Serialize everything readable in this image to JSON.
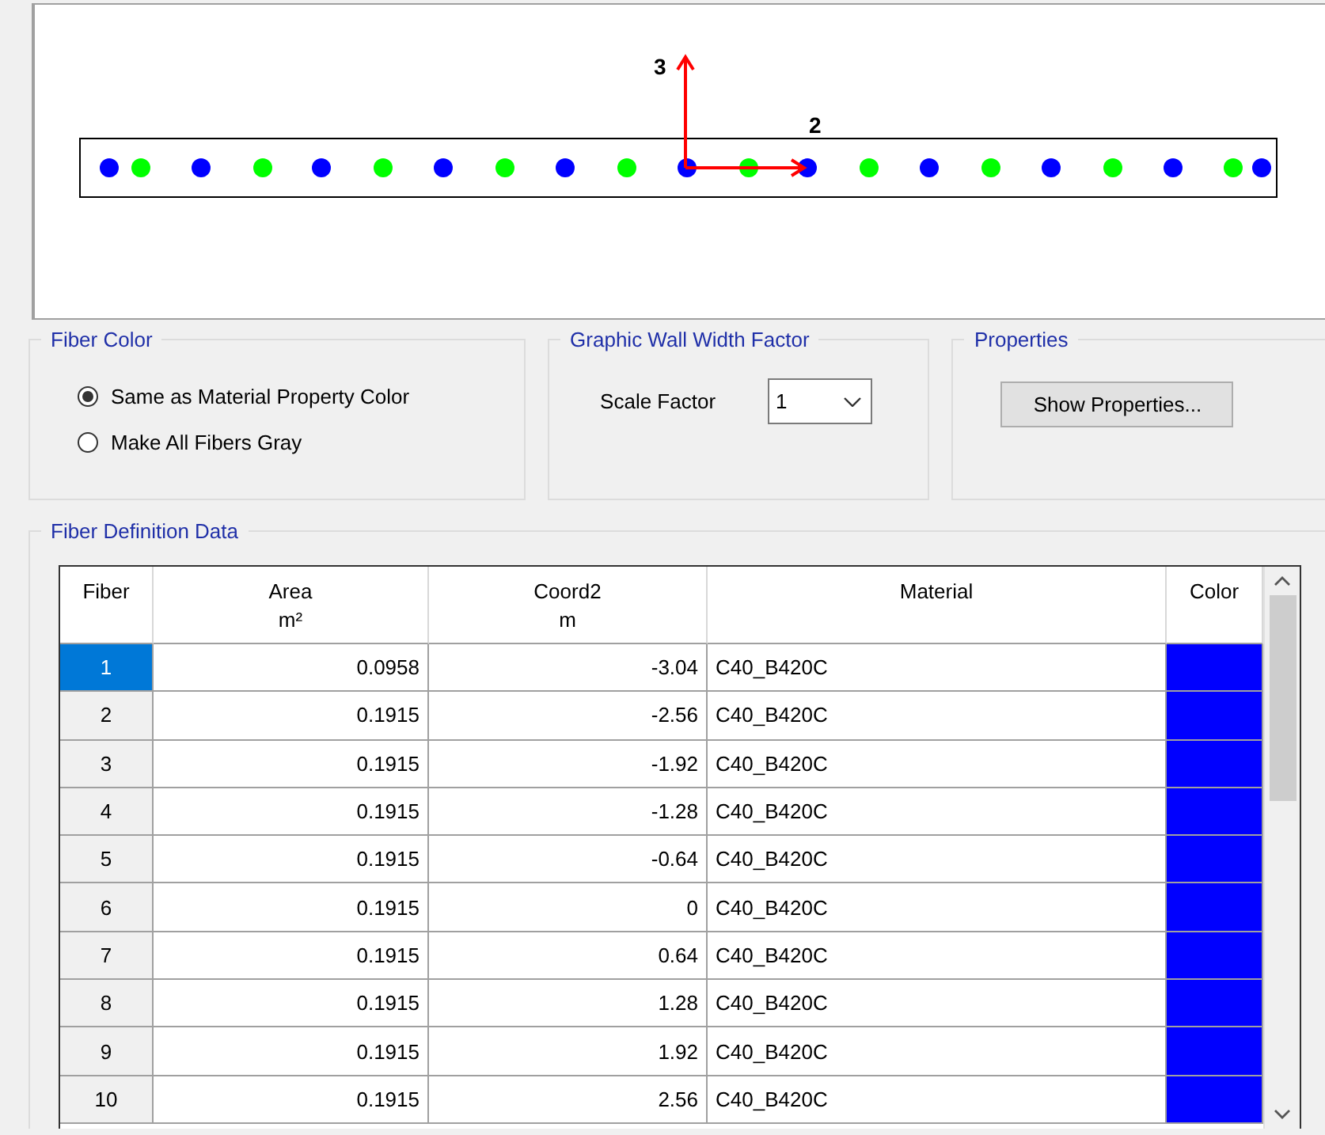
{
  "section_view": {
    "axis_vertical_label": "3",
    "axis_horizontal_label": "2"
  },
  "fiber_color": {
    "title": "Fiber Color",
    "options": [
      {
        "label": "Same as Material Property Color",
        "selected": true
      },
      {
        "label": "Make All Fibers Gray",
        "selected": false
      }
    ]
  },
  "wall_width": {
    "title": "Graphic Wall Width Factor",
    "label": "Scale Factor",
    "value": "1"
  },
  "properties": {
    "title": "Properties",
    "button": "Show Properties..."
  },
  "fiber_data": {
    "title": "Fiber Definition Data",
    "columns": [
      {
        "name": "Fiber"
      },
      {
        "name": "Area",
        "unit": "m²"
      },
      {
        "name": "Coord2",
        "unit": "m"
      },
      {
        "name": "Material"
      },
      {
        "name": "Color"
      }
    ],
    "rows": [
      {
        "fiber": "1",
        "area": "0.0958",
        "coord2": "-3.04",
        "material": "C40_B420C",
        "color": "#0000ff",
        "selected": true
      },
      {
        "fiber": "2",
        "area": "0.1915",
        "coord2": "-2.56",
        "material": "C40_B420C",
        "color": "#0000ff",
        "selected": false
      },
      {
        "fiber": "3",
        "area": "0.1915",
        "coord2": "-1.92",
        "material": "C40_B420C",
        "color": "#0000ff",
        "selected": false
      },
      {
        "fiber": "4",
        "area": "0.1915",
        "coord2": "-1.28",
        "material": "C40_B420C",
        "color": "#0000ff",
        "selected": false
      },
      {
        "fiber": "5",
        "area": "0.1915",
        "coord2": "-0.64",
        "material": "C40_B420C",
        "color": "#0000ff",
        "selected": false
      },
      {
        "fiber": "6",
        "area": "0.1915",
        "coord2": "0",
        "material": "C40_B420C",
        "color": "#0000ff",
        "selected": false
      },
      {
        "fiber": "7",
        "area": "0.1915",
        "coord2": "0.64",
        "material": "C40_B420C",
        "color": "#0000ff",
        "selected": false
      },
      {
        "fiber": "8",
        "area": "0.1915",
        "coord2": "1.28",
        "material": "C40_B420C",
        "color": "#0000ff",
        "selected": false
      },
      {
        "fiber": "9",
        "area": "0.1915",
        "coord2": "1.92",
        "material": "C40_B420C",
        "color": "#0000ff",
        "selected": false
      },
      {
        "fiber": "10",
        "area": "0.1915",
        "coord2": "2.56",
        "material": "C40_B420C",
        "color": "#0000ff",
        "selected": false
      }
    ]
  }
}
